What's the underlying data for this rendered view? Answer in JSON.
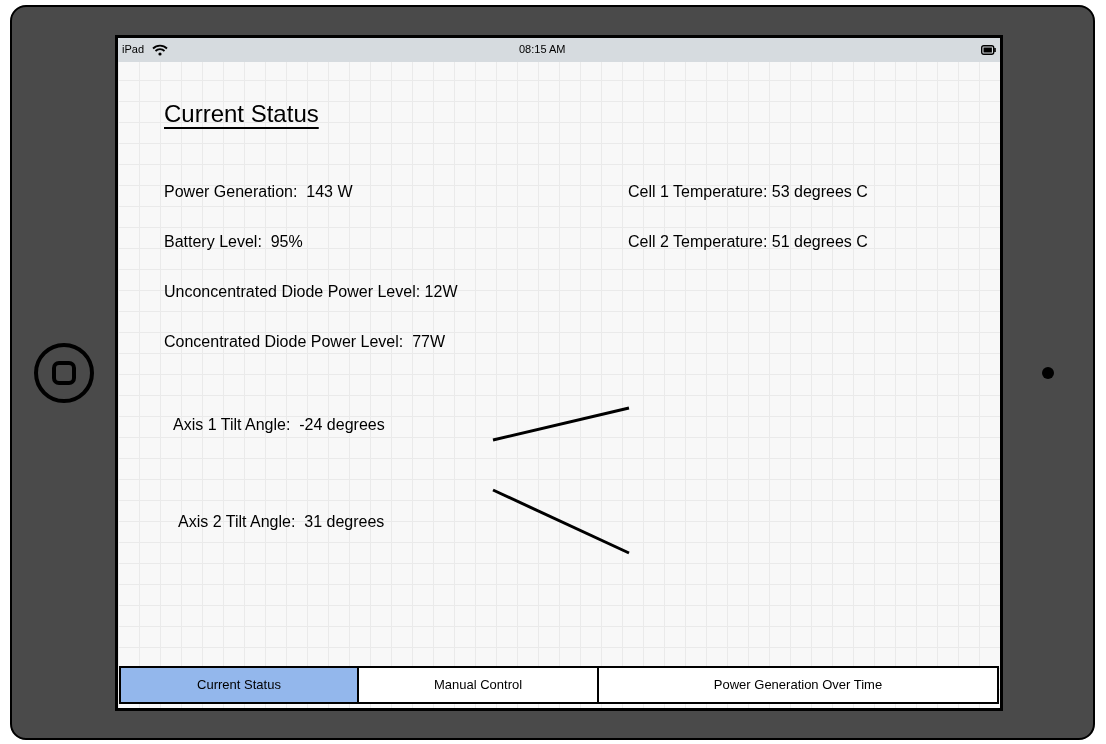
{
  "status_bar": {
    "device": "iPad",
    "time": "08:15 AM"
  },
  "title": "Current Status",
  "stats_left": [
    "Power Generation:  143 W",
    "Battery Level:  95%",
    "Unconcentrated Diode Power Level: 12W",
    "Concentrated Diode Power Level:  77W"
  ],
  "stats_right": [
    "Cell 1 Temperature: 53 degrees C",
    "Cell 2 Temperature: 51 degrees C"
  ],
  "tilt": [
    {
      "label": "Axis 1 Tilt Angle:  -24 degrees"
    },
    {
      "label": "Axis 2 Tilt Angle:  31 degrees"
    }
  ],
  "tabs": [
    {
      "label": "Current Status",
      "selected": true
    },
    {
      "label": "Manual Control",
      "selected": false
    },
    {
      "label": "Power Generation Over Time",
      "selected": false
    }
  ]
}
